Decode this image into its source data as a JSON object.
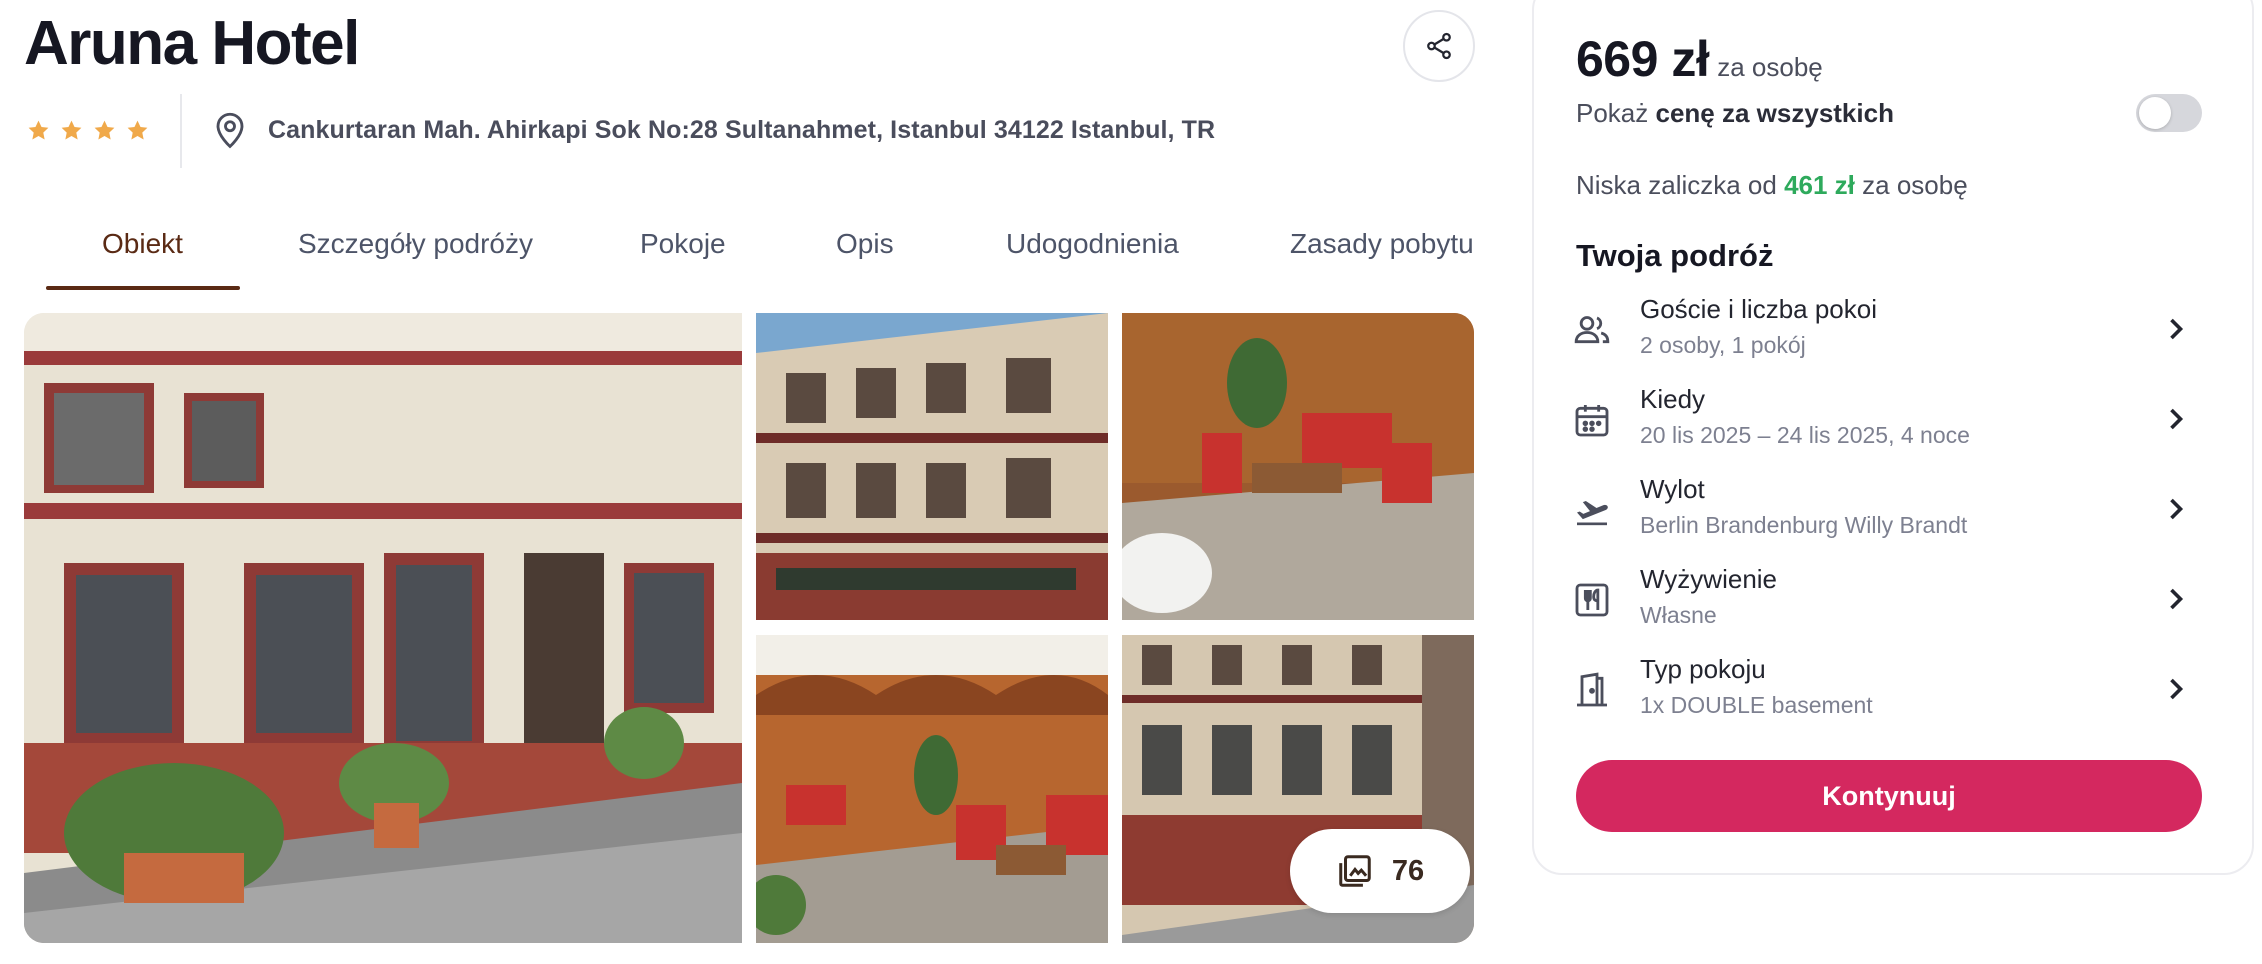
{
  "hotel": {
    "name": "Aruna Hotel",
    "stars": 4,
    "address": "Cankurtaran Mah. Ahirkapi Sok No:28 Sultanahmet, Istanbul 34122 Istanbul, TR"
  },
  "tabs": [
    {
      "label": "Obiekt",
      "active": true
    },
    {
      "label": "Szczegóły podróży",
      "active": false
    },
    {
      "label": "Pokoje",
      "active": false
    },
    {
      "label": "Opis",
      "active": false
    },
    {
      "label": "Udogodnienia",
      "active": false
    },
    {
      "label": "Zasady pobytu",
      "active": false
    }
  ],
  "gallery": {
    "photo_count": "76"
  },
  "booking": {
    "price": "669 zł",
    "per_person": "za osobę",
    "show_all_prefix": "Pokaż ",
    "show_all_bold": "cenę za wszystkich",
    "toggle_on": false,
    "deposit_prefix": "Niska zaliczka od ",
    "deposit_amount": "461 zł",
    "deposit_suffix": " za osobę",
    "trip_title": "Twoja podróż",
    "rows": [
      {
        "icon": "guests-icon",
        "label": "Goście i liczba pokoi",
        "value": "2 osoby, 1 pokój"
      },
      {
        "icon": "calendar-icon",
        "label": "Kiedy",
        "value": "20 lis 2025 – 24 lis 2025, 4 noce"
      },
      {
        "icon": "plane-departure-icon",
        "label": "Wylot",
        "value": "Berlin Brandenburg Willy Brandt"
      },
      {
        "icon": "meals-icon",
        "label": "Wyżywienie",
        "value": "Własne"
      },
      {
        "icon": "room-door-icon",
        "label": "Typ pokoju",
        "value": "1x DOUBLE basement"
      }
    ],
    "cta_label": "Kontynuuj"
  },
  "colors": {
    "accent": "#d4285f",
    "star": "#f0a94a",
    "tab_active": "#5a2a14",
    "deposit_green": "#2eaa5c"
  }
}
